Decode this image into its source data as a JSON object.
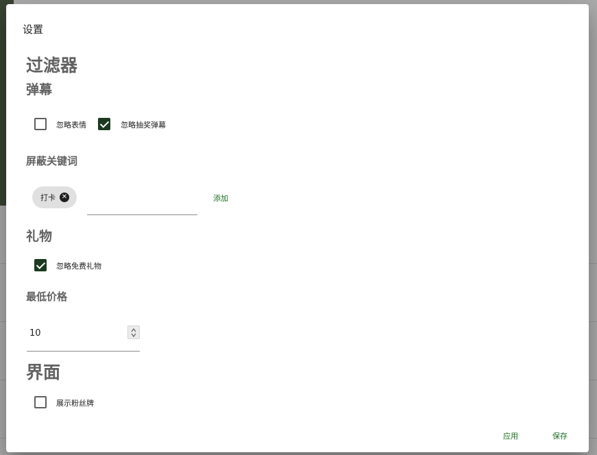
{
  "dialog": {
    "title": "设置",
    "filter_heading": "过滤器",
    "danmaku": {
      "heading": "弹幕",
      "ignore_emoji_label": "忽略表情",
      "ignore_emoji_checked": false,
      "ignore_lottery_label": "忽略抽奖弹幕",
      "ignore_lottery_checked": true,
      "block_keywords_heading": "屏蔽关键词",
      "keywords": [
        {
          "label": "打卡",
          "remove_icon": "close-circle-icon"
        }
      ],
      "keyword_input_value": "",
      "add_button_label": "添加"
    },
    "gift": {
      "heading": "礼物",
      "ignore_free_label": "忽略免费礼物",
      "ignore_free_checked": true,
      "min_price_heading": "最低价格",
      "min_price_value": "10"
    },
    "ui": {
      "heading": "界面",
      "show_fan_badge_label": "展示粉丝牌",
      "show_fan_badge_checked": false
    },
    "actions": {
      "apply_label": "应用",
      "save_label": "保存"
    }
  },
  "colors": {
    "accent": "#1c6e1f",
    "checkbox_checked": "#1b3a1f",
    "heading": "#616161",
    "overlay": "rgba(0,0,0,0.32)"
  }
}
